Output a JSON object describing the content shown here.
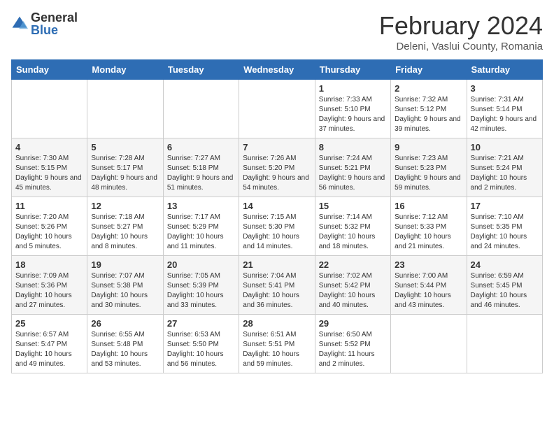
{
  "logo": {
    "general": "General",
    "blue": "Blue"
  },
  "title": {
    "month_year": "February 2024",
    "location": "Deleni, Vaslui County, Romania"
  },
  "days_of_week": [
    "Sunday",
    "Monday",
    "Tuesday",
    "Wednesday",
    "Thursday",
    "Friday",
    "Saturday"
  ],
  "weeks": [
    [
      {
        "day": "",
        "info": ""
      },
      {
        "day": "",
        "info": ""
      },
      {
        "day": "",
        "info": ""
      },
      {
        "day": "",
        "info": ""
      },
      {
        "day": "1",
        "info": "Sunrise: 7:33 AM\nSunset: 5:10 PM\nDaylight: 9 hours and 37 minutes."
      },
      {
        "day": "2",
        "info": "Sunrise: 7:32 AM\nSunset: 5:12 PM\nDaylight: 9 hours and 39 minutes."
      },
      {
        "day": "3",
        "info": "Sunrise: 7:31 AM\nSunset: 5:14 PM\nDaylight: 9 hours and 42 minutes."
      }
    ],
    [
      {
        "day": "4",
        "info": "Sunrise: 7:30 AM\nSunset: 5:15 PM\nDaylight: 9 hours and 45 minutes."
      },
      {
        "day": "5",
        "info": "Sunrise: 7:28 AM\nSunset: 5:17 PM\nDaylight: 9 hours and 48 minutes."
      },
      {
        "day": "6",
        "info": "Sunrise: 7:27 AM\nSunset: 5:18 PM\nDaylight: 9 hours and 51 minutes."
      },
      {
        "day": "7",
        "info": "Sunrise: 7:26 AM\nSunset: 5:20 PM\nDaylight: 9 hours and 54 minutes."
      },
      {
        "day": "8",
        "info": "Sunrise: 7:24 AM\nSunset: 5:21 PM\nDaylight: 9 hours and 56 minutes."
      },
      {
        "day": "9",
        "info": "Sunrise: 7:23 AM\nSunset: 5:23 PM\nDaylight: 9 hours and 59 minutes."
      },
      {
        "day": "10",
        "info": "Sunrise: 7:21 AM\nSunset: 5:24 PM\nDaylight: 10 hours and 2 minutes."
      }
    ],
    [
      {
        "day": "11",
        "info": "Sunrise: 7:20 AM\nSunset: 5:26 PM\nDaylight: 10 hours and 5 minutes."
      },
      {
        "day": "12",
        "info": "Sunrise: 7:18 AM\nSunset: 5:27 PM\nDaylight: 10 hours and 8 minutes."
      },
      {
        "day": "13",
        "info": "Sunrise: 7:17 AM\nSunset: 5:29 PM\nDaylight: 10 hours and 11 minutes."
      },
      {
        "day": "14",
        "info": "Sunrise: 7:15 AM\nSunset: 5:30 PM\nDaylight: 10 hours and 14 minutes."
      },
      {
        "day": "15",
        "info": "Sunrise: 7:14 AM\nSunset: 5:32 PM\nDaylight: 10 hours and 18 minutes."
      },
      {
        "day": "16",
        "info": "Sunrise: 7:12 AM\nSunset: 5:33 PM\nDaylight: 10 hours and 21 minutes."
      },
      {
        "day": "17",
        "info": "Sunrise: 7:10 AM\nSunset: 5:35 PM\nDaylight: 10 hours and 24 minutes."
      }
    ],
    [
      {
        "day": "18",
        "info": "Sunrise: 7:09 AM\nSunset: 5:36 PM\nDaylight: 10 hours and 27 minutes."
      },
      {
        "day": "19",
        "info": "Sunrise: 7:07 AM\nSunset: 5:38 PM\nDaylight: 10 hours and 30 minutes."
      },
      {
        "day": "20",
        "info": "Sunrise: 7:05 AM\nSunset: 5:39 PM\nDaylight: 10 hours and 33 minutes."
      },
      {
        "day": "21",
        "info": "Sunrise: 7:04 AM\nSunset: 5:41 PM\nDaylight: 10 hours and 36 minutes."
      },
      {
        "day": "22",
        "info": "Sunrise: 7:02 AM\nSunset: 5:42 PM\nDaylight: 10 hours and 40 minutes."
      },
      {
        "day": "23",
        "info": "Sunrise: 7:00 AM\nSunset: 5:44 PM\nDaylight: 10 hours and 43 minutes."
      },
      {
        "day": "24",
        "info": "Sunrise: 6:59 AM\nSunset: 5:45 PM\nDaylight: 10 hours and 46 minutes."
      }
    ],
    [
      {
        "day": "25",
        "info": "Sunrise: 6:57 AM\nSunset: 5:47 PM\nDaylight: 10 hours and 49 minutes."
      },
      {
        "day": "26",
        "info": "Sunrise: 6:55 AM\nSunset: 5:48 PM\nDaylight: 10 hours and 53 minutes."
      },
      {
        "day": "27",
        "info": "Sunrise: 6:53 AM\nSunset: 5:50 PM\nDaylight: 10 hours and 56 minutes."
      },
      {
        "day": "28",
        "info": "Sunrise: 6:51 AM\nSunset: 5:51 PM\nDaylight: 10 hours and 59 minutes."
      },
      {
        "day": "29",
        "info": "Sunrise: 6:50 AM\nSunset: 5:52 PM\nDaylight: 11 hours and 2 minutes."
      },
      {
        "day": "",
        "info": ""
      },
      {
        "day": "",
        "info": ""
      }
    ]
  ]
}
